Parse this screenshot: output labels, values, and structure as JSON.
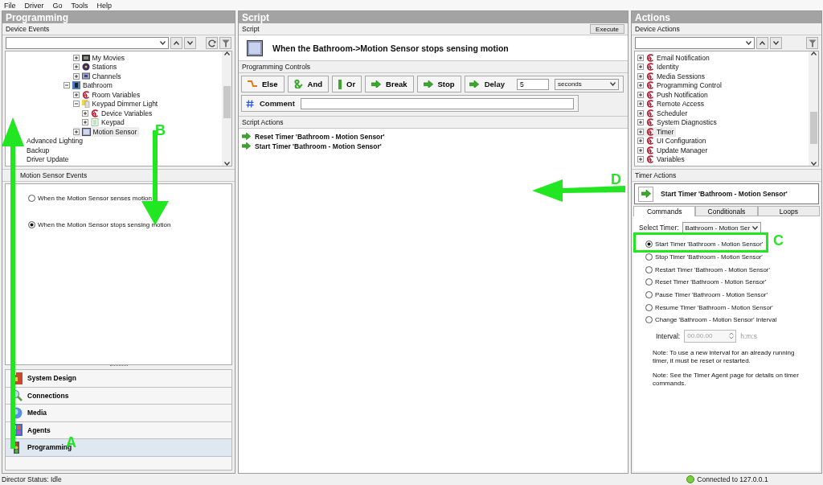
{
  "menu": [
    {
      "label": "File"
    },
    {
      "label": "Driver"
    },
    {
      "label": "Go"
    },
    {
      "label": "Tools"
    },
    {
      "label": "Help"
    }
  ],
  "programming": {
    "title": "Programming",
    "section": "Device Events",
    "tree": [
      {
        "children": [
          {
            "children": [
              {
                "children": [
                  {
                    "children": [
                      {
                        "children": [
                          {
                            "label": "My Movies",
                            "kind": "movies",
                            "expanded": false,
                            "selected": false
                          },
                          {
                            "label": "Stations",
                            "kind": "disc",
                            "expanded": false,
                            "selected": false
                          },
                          {
                            "label": "Channels",
                            "kind": "channels",
                            "expanded": false,
                            "selected": false
                          }
                        ]
                      },
                      {
                        "label": "Bathroom",
                        "kind": "room",
                        "expanded": true,
                        "selected": false,
                        "children": [
                          {
                            "label": "Room Variables",
                            "kind": "agent",
                            "expanded": false,
                            "selected": false
                          },
                          {
                            "label": "Keypad Dimmer Light",
                            "kind": "light",
                            "expanded": true,
                            "selected": false,
                            "children": [
                              {
                                "label": "Device Variables",
                                "kind": "agent",
                                "expanded": false,
                                "selected": false
                              },
                              {
                                "label": "Keypad",
                                "kind": "keypad",
                                "expanded": false,
                                "selected": false
                              }
                            ]
                          },
                          {
                            "label": "Motion Sensor",
                            "kind": "sensor",
                            "expanded": false,
                            "selected": true
                          }
                        ]
                      }
                    ]
                  }
                ]
              }
            ]
          }
        ]
      },
      {
        "label": "Advanced Lighting",
        "selected": false
      },
      {
        "label": "Backup",
        "selected": false
      },
      {
        "label": "Driver Update",
        "selected": false
      }
    ],
    "events_title": "Motion Sensor Events",
    "events": [
      {
        "label": "When the Motion Sensor senses motion",
        "selected": false
      },
      {
        "label": "When the Motion Sensor stops sensing motion",
        "selected": true
      }
    ],
    "nav": [
      {
        "label": "System Design",
        "kind": "design",
        "selected": false
      },
      {
        "label": "Connections",
        "kind": "connections",
        "selected": false
      },
      {
        "label": "Media",
        "kind": "media",
        "selected": false
      },
      {
        "label": "Agents",
        "kind": "agents",
        "selected": false
      },
      {
        "label": "Programming",
        "kind": "programming",
        "selected": true
      }
    ]
  },
  "script": {
    "title": "Script",
    "section": "Script",
    "execute": "Execute",
    "event": "When the Bathroom->Motion Sensor stops sensing motion",
    "controls_label": "Programming Controls",
    "controls": [
      {
        "label": "Else",
        "kind": "else"
      },
      {
        "label": "And",
        "kind": "and"
      },
      {
        "label": "Or",
        "kind": "or"
      },
      {
        "label": "Break",
        "kind": "arrow"
      },
      {
        "label": "Stop",
        "kind": "arrow"
      }
    ],
    "delay": {
      "label": "Delay",
      "value": "5",
      "unit": "seconds"
    },
    "comment": {
      "label": "Comment"
    },
    "actions_label": "Script Actions",
    "actions": [
      {
        "label": "Reset Timer 'Bathroom - Motion Sensor'"
      },
      {
        "label": "Start Timer 'Bathroom - Motion Sensor'"
      }
    ]
  },
  "actions": {
    "title": "Actions",
    "section": "Device Actions",
    "tree": [
      {
        "label": "Email Notification",
        "kind": "agent",
        "expanded": false,
        "selected": false
      },
      {
        "label": "Identity",
        "kind": "agent",
        "expanded": false,
        "selected": false
      },
      {
        "label": "Media Sessions",
        "kind": "agent",
        "expanded": false,
        "selected": false
      },
      {
        "label": "Programming Control",
        "kind": "agent",
        "expanded": false,
        "selected": false
      },
      {
        "label": "Push Notification",
        "kind": "agent",
        "expanded": false,
        "selected": false
      },
      {
        "label": "Remote Access",
        "kind": "agent",
        "expanded": false,
        "selected": false
      },
      {
        "label": "Scheduler",
        "kind": "agent",
        "expanded": false,
        "selected": false
      },
      {
        "label": "System Diagnostics",
        "kind": "agent",
        "expanded": false,
        "selected": false
      },
      {
        "label": "Timer",
        "kind": "agent",
        "expanded": false,
        "selected": true
      },
      {
        "label": "UI Configuration",
        "kind": "agent",
        "expanded": false,
        "selected": false
      },
      {
        "label": "Update Manager",
        "kind": "agent",
        "expanded": false,
        "selected": false
      },
      {
        "label": "Variables",
        "kind": "agent",
        "expanded": false,
        "selected": false
      }
    ],
    "timer_label": "Timer Actions",
    "current": "Start Timer 'Bathroom - Motion Sensor'",
    "tabs": [
      {
        "label": "Commands",
        "selected": true
      },
      {
        "label": "Conditionals",
        "selected": false
      },
      {
        "label": "Loops",
        "selected": false
      }
    ],
    "select_label": "Select Timer:",
    "select_value": "Bathroom - Motion Ser",
    "commands": [
      {
        "label": "Start Timer 'Bathroom - Motion Sensor'",
        "selected": true
      },
      {
        "label": "Stop Timer 'Bathroom - Motion Sensor'",
        "selected": false
      },
      {
        "label": "Restart Timer 'Bathroom - Motion Sensor'",
        "selected": false
      },
      {
        "label": "Reset Timer 'Bathroom - Motion Sensor'",
        "selected": false
      },
      {
        "label": "Pause Timer 'Bathroom - Motion Sensor'",
        "selected": false
      },
      {
        "label": "Resume Timer 'Bathroom - Motion Sensor'",
        "selected": false
      },
      {
        "label": "Change 'Bathroom - Motion Sensor' Interval",
        "selected": false
      }
    ],
    "interval": {
      "label": "Interval:",
      "value": "00.00.00",
      "unit": "h:m:s",
      "disabled": true
    },
    "notes": [
      "Note: To use a new interval for an already running timer, it must be reset or restarted.",
      "Note: See the Timer Agent page for details on timer commands."
    ]
  },
  "status": {
    "left": "Director Status: Idle",
    "right": "Connected to 127.0.0.1"
  },
  "annotations": [
    {
      "kind": "arrow",
      "label": "A"
    },
    {
      "kind": "arrow",
      "label": "B"
    },
    {
      "kind": "box",
      "label": "C"
    },
    {
      "kind": "arrow",
      "label": "D"
    }
  ]
}
